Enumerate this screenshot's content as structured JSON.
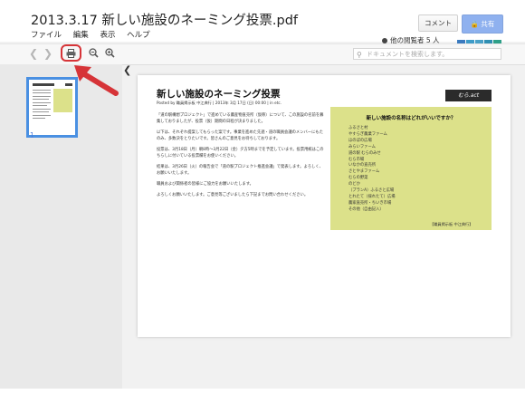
{
  "header": {
    "title": "2013.3.17 新しい施設のネーミング投票.pdf",
    "menu": [
      "ファイル",
      "編集",
      "表示",
      "ヘルプ"
    ],
    "comment_label": "コメント",
    "share_label": "共有",
    "viewers_label": "他の閲覧者 5 人",
    "avatar_colors": [
      "#3a7abf",
      "#3d9bc8",
      "#48a0c7",
      "#2f8fb3",
      "#2fa089"
    ]
  },
  "toolbar": {
    "back_icon": "chevron-left-icon",
    "forward_icon": "chevron-right-icon",
    "print_icon": "printer-icon",
    "zoom_out_icon": "zoom-out-icon",
    "zoom_in_icon": "zoom-in-icon",
    "search_placeholder": "ドキュメントを検索します。",
    "highlight_color": "#d63438"
  },
  "sidebar": {
    "page_number": "1",
    "collapse_icon": "chevron-left-icon"
  },
  "document": {
    "title": "新しい施設のネーミング投票",
    "meta": "Posted by 職員掲示板  中江典行 | 2013年 3月 17日 (日) 00:00 | in etc.",
    "logo": "むら.act",
    "paragraphs": [
      "「道の駅構想プロジェクト」で進めている農産物直売所（仮称）について、この施設の名前を募集しておりましたが、投票（仮）期間の日程が決まりました。",
      "以下は、それぞれ提案してもらった案です。事業を進めた先週・道の職員会議のメンバーにもたのみ、多数決をとりたいです。皆さんのご意見をお待ちしております。",
      "投票は、3月18日（月）朝8時〜3月22日（金）夕方5時までを予定しています。投票用紙はこのちらしに付いている投票欄をお使いください。",
      "結果は、3月26日（火）の報告会で「道の駅プロジェクト推進会議」で発表します。よろしく、お願いいたします。",
      "職員および関係者の皆様にご協力をお願いいたします。",
      "よろしくお願いいたします。ご意見等ございましたら下記までお問い合わせください。"
    ],
    "vote_heading": "新しい施設の名称はどれがいいですか？",
    "vote_options": [
      "ふるさと村",
      "やすらぎ農業ファーム",
      "ほのぼの広場",
      "みらいファーム",
      "道の駅 むらのみせ",
      "むら市場",
      "いなかの直売所",
      "さとやまファーム",
      "むらの野菜",
      "のどか",
      "（プランA）ふるさと広場",
      "とれたて（採れたて）広場",
      "農家直売所・ちいき市場",
      "その他（自由記入）"
    ],
    "vote_footer": "【職員掲示板  中江典行】"
  }
}
